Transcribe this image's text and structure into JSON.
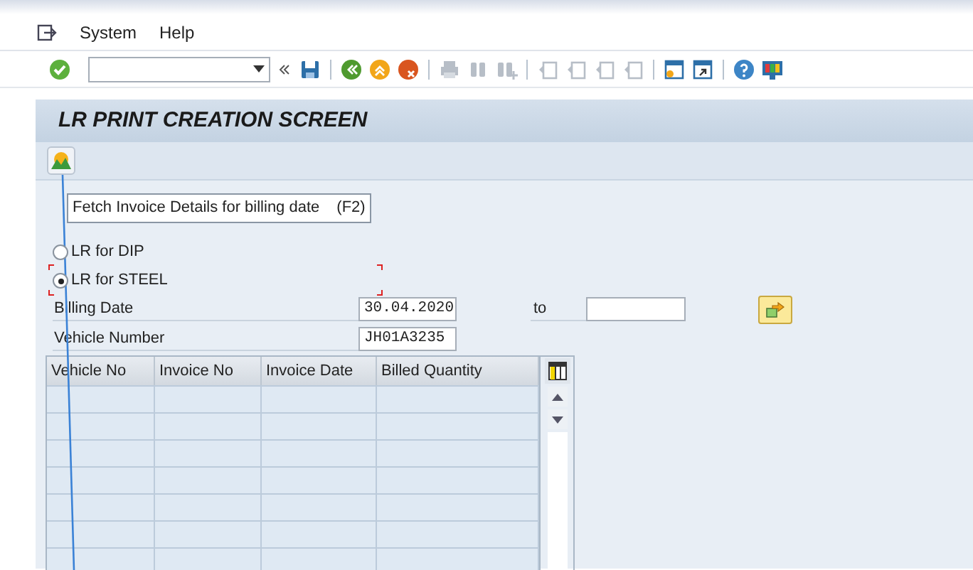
{
  "menu": [
    {
      "label": "System"
    },
    {
      "label": "Help"
    }
  ],
  "screen_title": "LR PRINT CREATION SCREEN",
  "tooltip": {
    "text": "Fetch Invoice Details for billing date",
    "shortcut": "(F2)"
  },
  "radios": [
    {
      "label": "LR for DIP",
      "selected": false
    },
    {
      "label": "LR for STEEL",
      "selected": true
    }
  ],
  "billing_date": {
    "label": "Billing Date",
    "value": "30.04.2020",
    "to_label": "to"
  },
  "vehicle_number": {
    "label": "Vehicle Number",
    "value": "JH01A3235"
  },
  "table": {
    "columns": [
      "Vehicle No",
      "Invoice No",
      "Invoice Date",
      "Billed Quantity"
    ]
  }
}
